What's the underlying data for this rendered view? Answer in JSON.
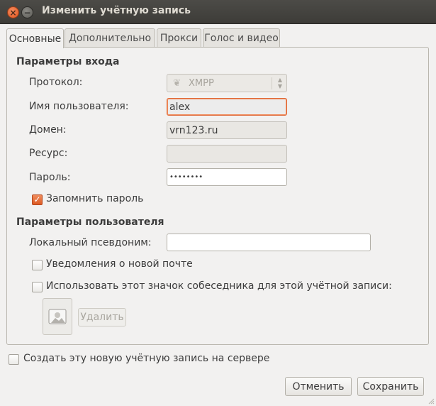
{
  "window": {
    "title": "Изменить учётную запись"
  },
  "tabs": [
    {
      "label": "Основные",
      "active": true
    },
    {
      "label": "Дополнительно",
      "active": false
    },
    {
      "label": "Прокси",
      "active": false
    },
    {
      "label": "Голос и видео",
      "active": false
    }
  ],
  "login": {
    "section_title": "Параметры входа",
    "protocol_label": "Протокол:",
    "protocol_value": "XMPP",
    "username_label": "Имя пользователя:",
    "username_value": "alex",
    "domain_label": "Домен:",
    "domain_value": "vrn123.ru",
    "resource_label": "Ресурс:",
    "resource_value": "",
    "password_label": "Пароль:",
    "password_value": "••••••••",
    "remember_label": "Запомнить пароль",
    "remember_checked": true
  },
  "user": {
    "section_title": "Параметры пользователя",
    "alias_label": "Локальный псевдоним:",
    "alias_value": "",
    "mail_notify_label": "Уведомления о новой почте",
    "mail_notify_checked": false,
    "buddy_icon_label": "Использовать этот значок собеседника для этой учётной записи:",
    "buddy_icon_checked": false,
    "remove_label": "Удалить"
  },
  "footer": {
    "create_on_server_label": "Создать эту новую учётную запись на сервере",
    "create_on_server_checked": false,
    "cancel_label": "Отменить",
    "save_label": "Сохранить"
  },
  "colors": {
    "accent": "#dd5a24",
    "titlebar": "#3d3c38",
    "window_bg": "#f2f1f0"
  }
}
